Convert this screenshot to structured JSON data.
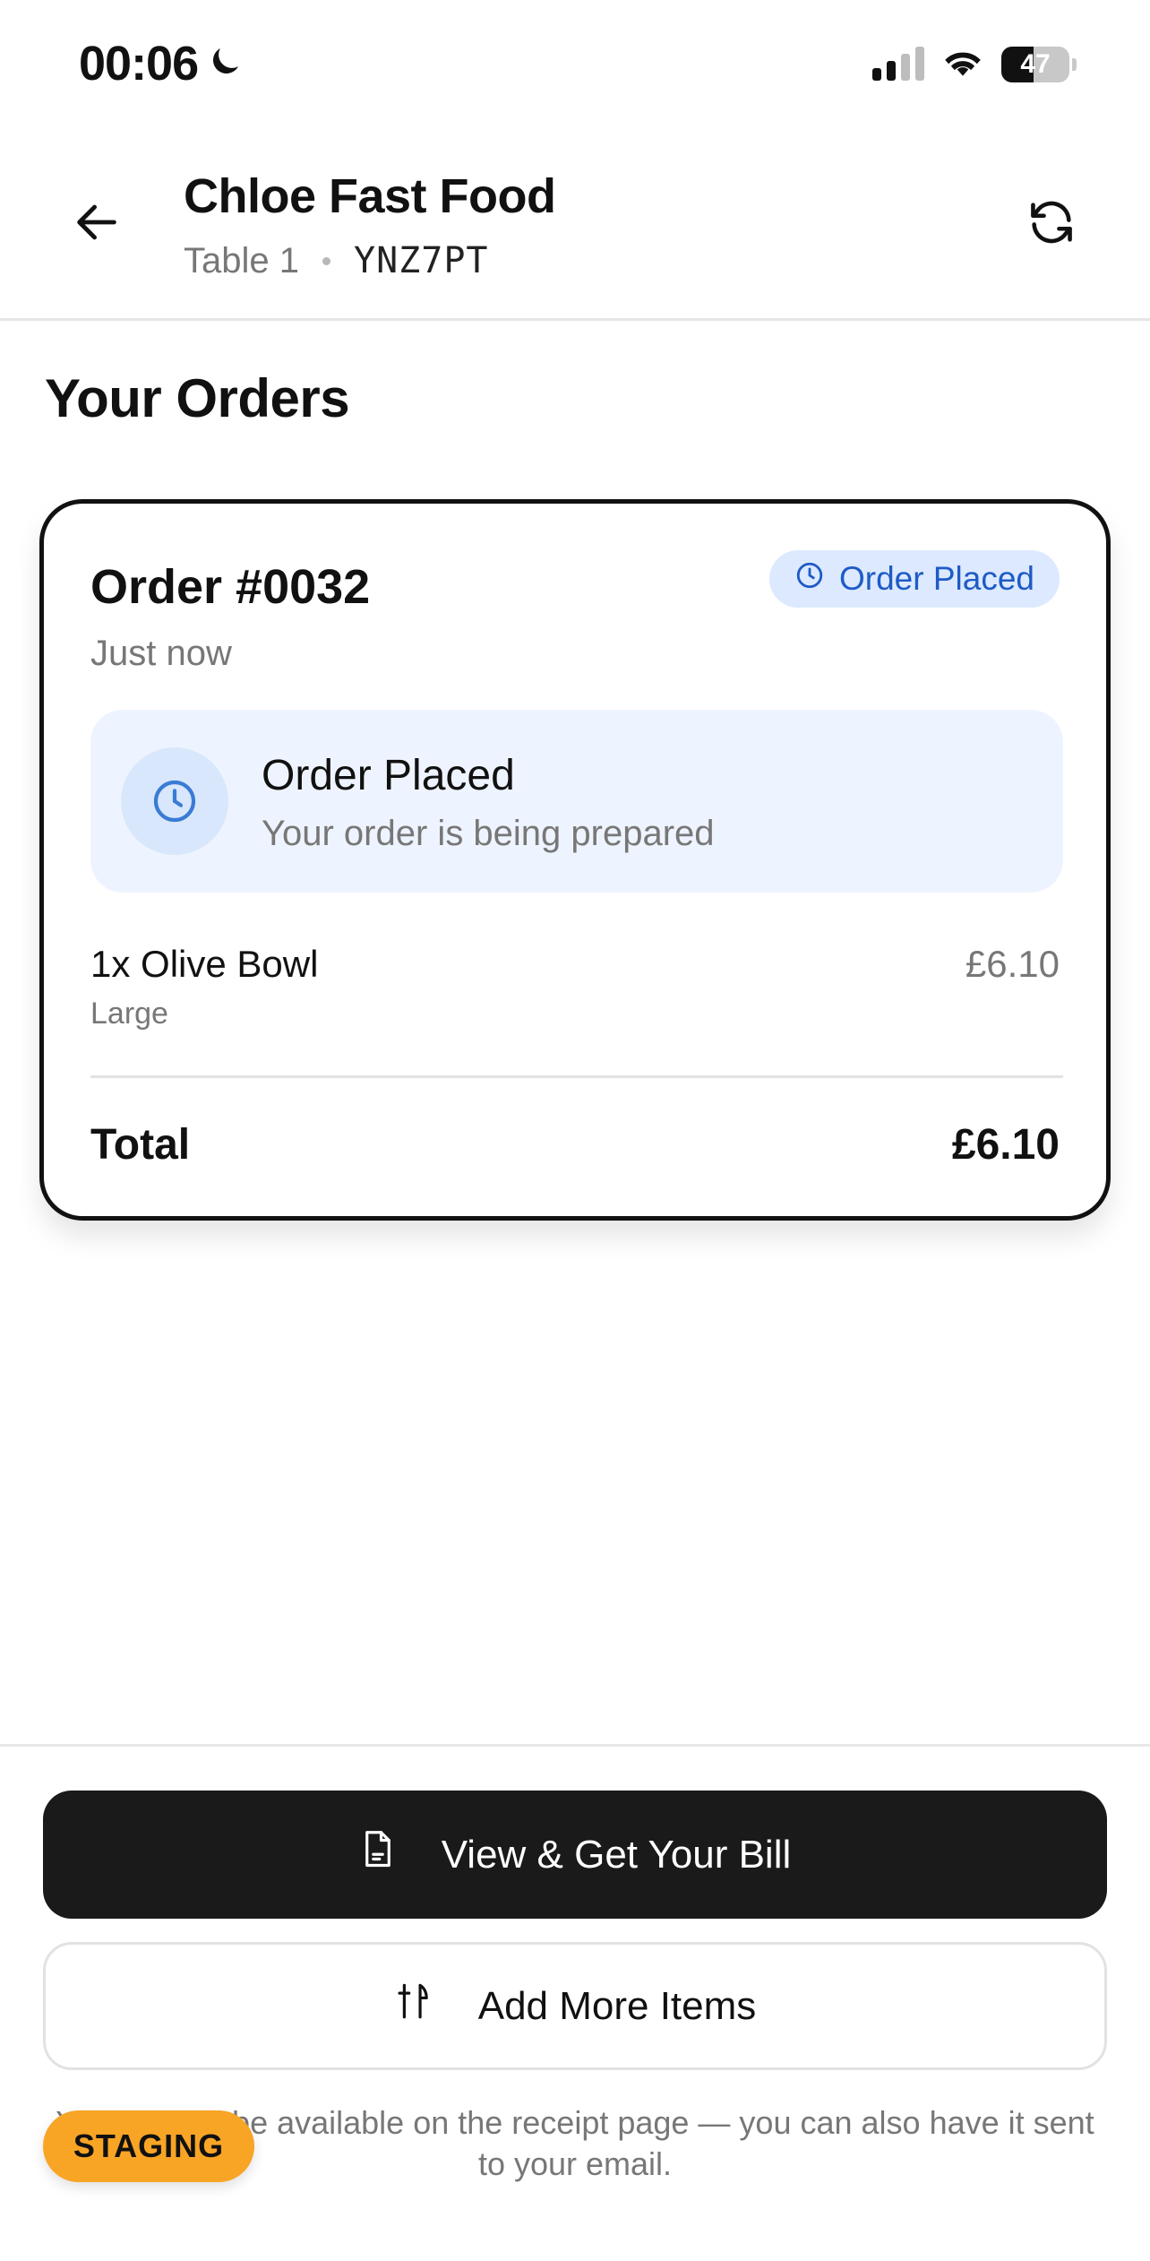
{
  "status_bar": {
    "time": "00:06",
    "battery": "47",
    "battery_level": 0.47,
    "icons": [
      "moon-icon",
      "signal-icon",
      "wifi-icon",
      "battery-icon"
    ]
  },
  "header": {
    "restaurant_name": "Chloe Fast Food",
    "table_label": "Table 1",
    "session_code": "YNZ7PT",
    "back_icon": "arrow-left-icon",
    "refresh_icon": "refresh-icon"
  },
  "page": {
    "title": "Your Orders"
  },
  "order": {
    "number": "Order #0032",
    "time": "Just now",
    "badge_label": "Order Placed",
    "status_title": "Order Placed",
    "status_message": "Your order is being prepared",
    "items": [
      {
        "name": "1x Olive Bowl",
        "variant": "Large",
        "price": "£6.10"
      }
    ],
    "total_label": "Total",
    "total_value": "£6.10"
  },
  "actions": {
    "bill_button": "View & Get Your Bill",
    "add_button": "Add More Items",
    "footer_note": "Your bill will be available on the receipt page — you can also have it sent to your email."
  },
  "env_badge": "STAGING",
  "colors": {
    "accent_blue": "#1e5bc6",
    "badge_bg": "#dce9ff",
    "panel_bg": "#eef4ff",
    "primary_button": "#1a1a1a",
    "staging": "#f8a425"
  }
}
